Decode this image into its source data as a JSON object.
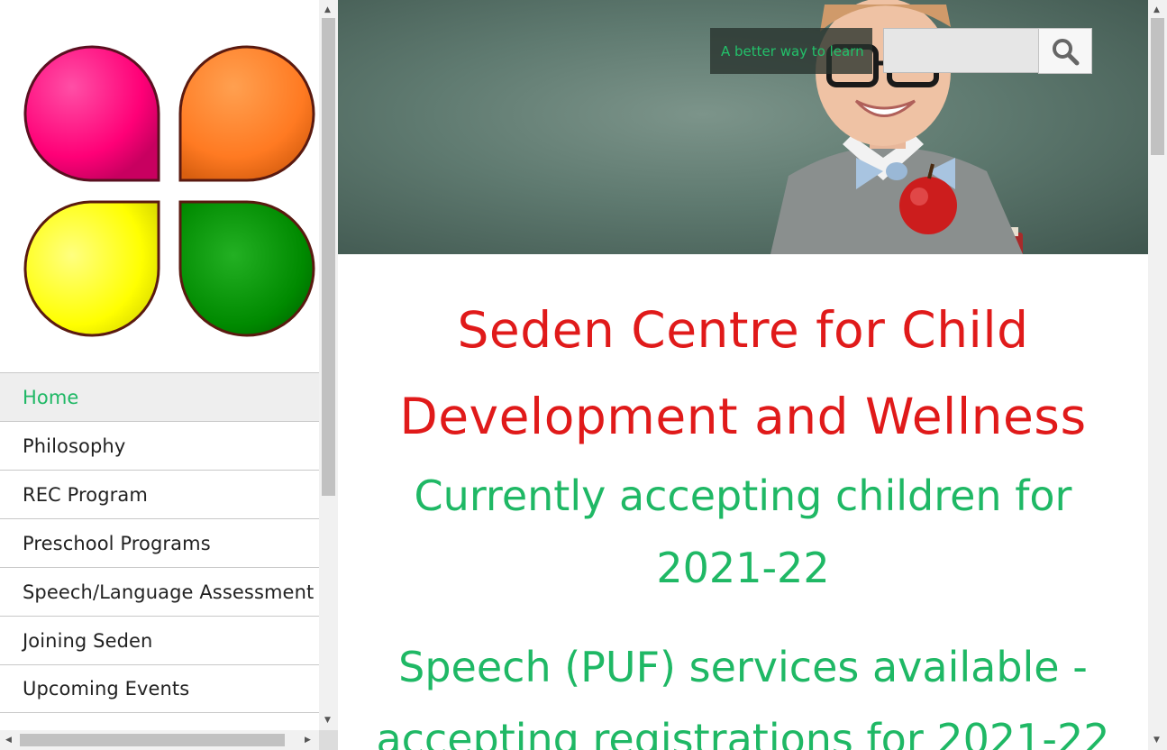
{
  "sidebar": {
    "logo_name": "four-petal-logo",
    "logo_colors": [
      "#ff0077",
      "#ff7a22",
      "#ffff00",
      "#008a00"
    ],
    "nav": [
      {
        "label": "Home",
        "active": true
      },
      {
        "label": "Philosophy"
      },
      {
        "label": "REC Program"
      },
      {
        "label": "Preschool Programs"
      },
      {
        "label": "Speech/Language Assessment"
      },
      {
        "label": "Joining Seden"
      },
      {
        "label": "Upcoming Events"
      }
    ]
  },
  "header": {
    "tagline": "A better way to learn",
    "search": {
      "value": "",
      "placeholder": ""
    },
    "search_icon": "search-icon"
  },
  "content": {
    "title": "Seden Centre for Child Development and Wellness",
    "notice1": "Currently accepting children for 2021-22",
    "notice2": "Speech (PUF) services available - accepting registrations for 2021-22"
  },
  "colors": {
    "accent_green": "#1fb865",
    "title_red": "#e01a1a",
    "nav_active_bg": "#eeeeee"
  }
}
